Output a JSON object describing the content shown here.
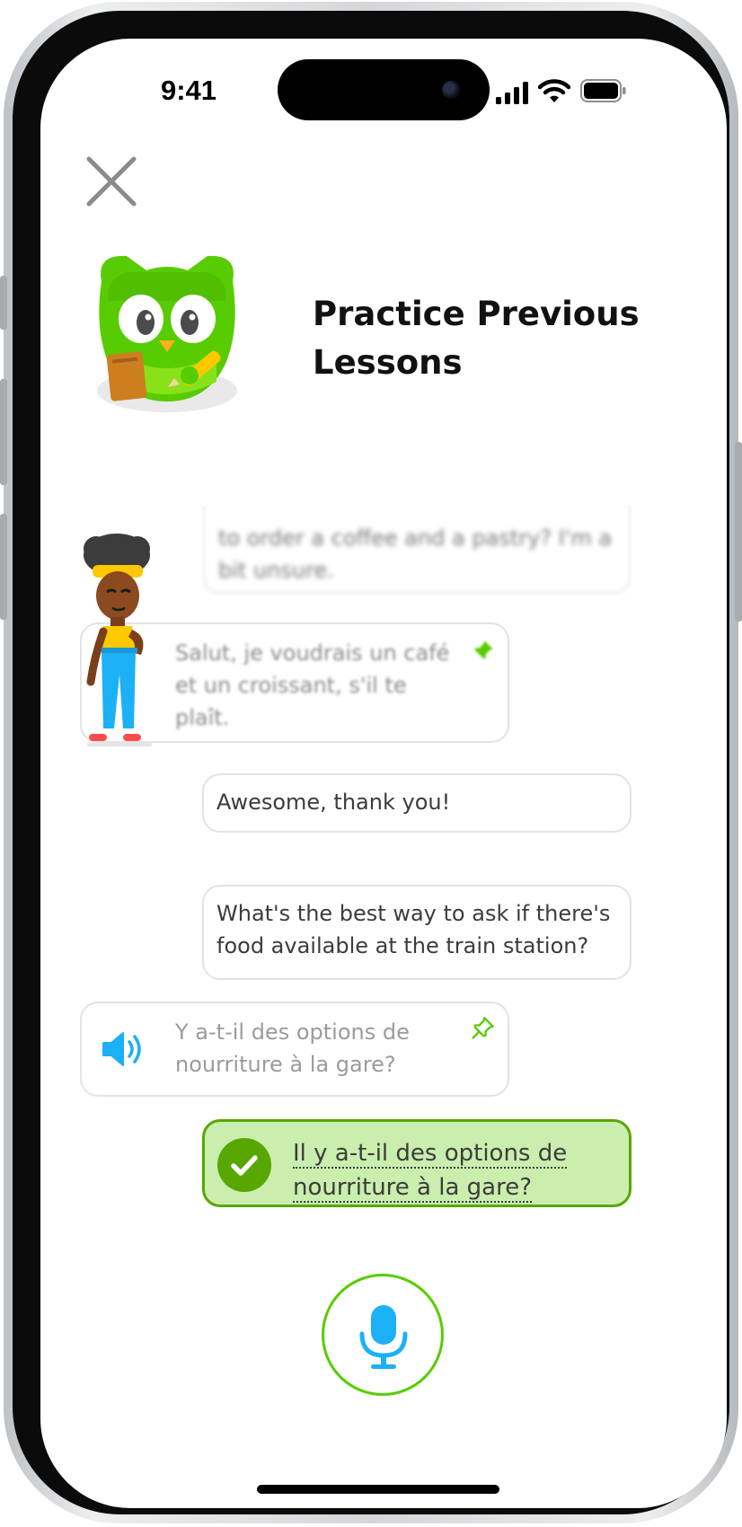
{
  "status_bar": {
    "time": "9:41"
  },
  "header": {
    "title": "Practice Previous Lessons"
  },
  "chat": {
    "blurred_user_message": "Could you please give me the French to order a coffee and a pastry? I'm a bit unsure.",
    "blurred_user_message_lines": [
      "to order a coffee and a pastry? I'm a",
      "bit unsure."
    ],
    "character_reply_lines": [
      "Salut, je voudrais un café",
      "et un croissant, s'il te",
      "plaît."
    ],
    "user_message_1": "Awesome, thank you!",
    "user_message_2_lines": [
      "What's the best way to ask if there's",
      "food available at the train station?"
    ],
    "character_prompt_lines": [
      "Y a-t-il des options de",
      "nourriture à la gare?"
    ],
    "answer_lines": [
      "Il y a-t-il des options de",
      "nourriture à la gare?"
    ]
  },
  "icons": {
    "close": "close-icon",
    "pin": "pin-icon",
    "speaker": "speaker-icon",
    "check": "check-icon",
    "microphone": "microphone-icon"
  },
  "colors": {
    "green_accent": "#58cc02",
    "answer_bg": "#c9eeae",
    "answer_border": "#58a700",
    "blue": "#1cb0f6"
  }
}
